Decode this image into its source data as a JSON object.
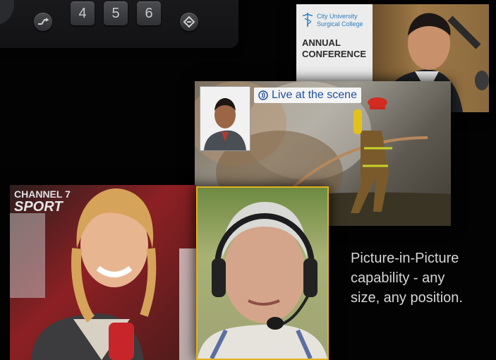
{
  "keypad": {
    "keys": [
      "4",
      "5",
      "6"
    ]
  },
  "conference": {
    "university_line1": "City University",
    "university_line2": "Surgical College",
    "title_line1": "ANNUAL",
    "title_line2": "CONFERENCE"
  },
  "scene": {
    "badge_text": "Live at the scene"
  },
  "sport": {
    "channel": "CHANNEL 7",
    "brand": "SPORT"
  },
  "caption": {
    "line1": "Picture-in-Picture",
    "line2": "capability - any",
    "line3": "size, any position."
  },
  "colors": {
    "accent": "#e0b120",
    "badge_text": "#1f4f9a"
  }
}
